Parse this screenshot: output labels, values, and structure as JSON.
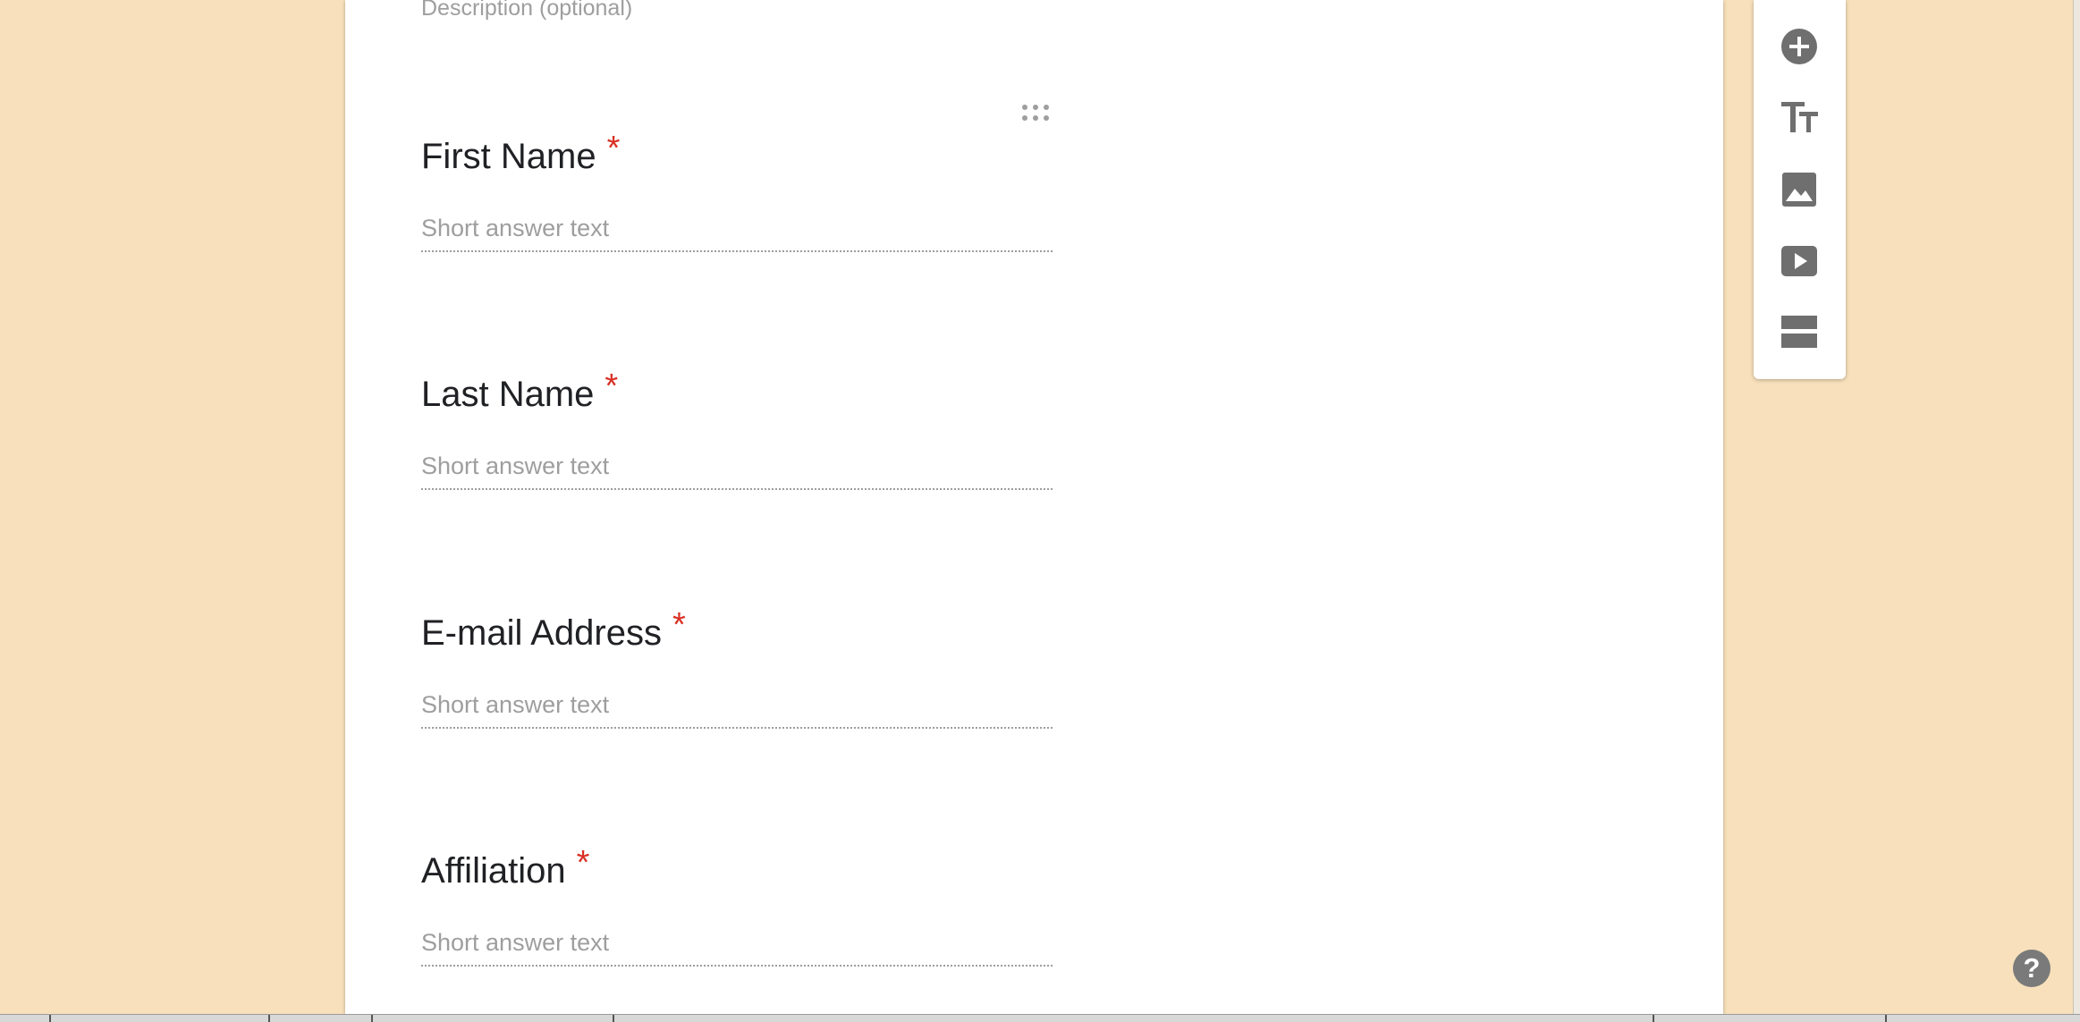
{
  "form": {
    "description_placeholder": "Description (optional)",
    "questions": [
      {
        "title": "First Name",
        "required_mark": "*",
        "answer_placeholder": "Short answer text"
      },
      {
        "title": "Last Name",
        "required_mark": "*",
        "answer_placeholder": "Short answer text"
      },
      {
        "title": "E-mail Address",
        "required_mark": "*",
        "answer_placeholder": "Short answer text"
      },
      {
        "title": "Affiliation",
        "required_mark": "*",
        "answer_placeholder": "Short answer text"
      }
    ]
  },
  "toolbar": {
    "items": [
      {
        "icon": "add-question-icon"
      },
      {
        "icon": "title-text-icon"
      },
      {
        "icon": "image-icon"
      },
      {
        "icon": "video-icon"
      },
      {
        "icon": "section-icon"
      }
    ]
  },
  "help": {
    "label": "?"
  },
  "colors": {
    "page_background": "#f7e0bb",
    "card_background": "#ffffff",
    "required_star": "#d93025",
    "placeholder_text": "#9e9e9e",
    "icon_gray": "#6f6f6f"
  }
}
